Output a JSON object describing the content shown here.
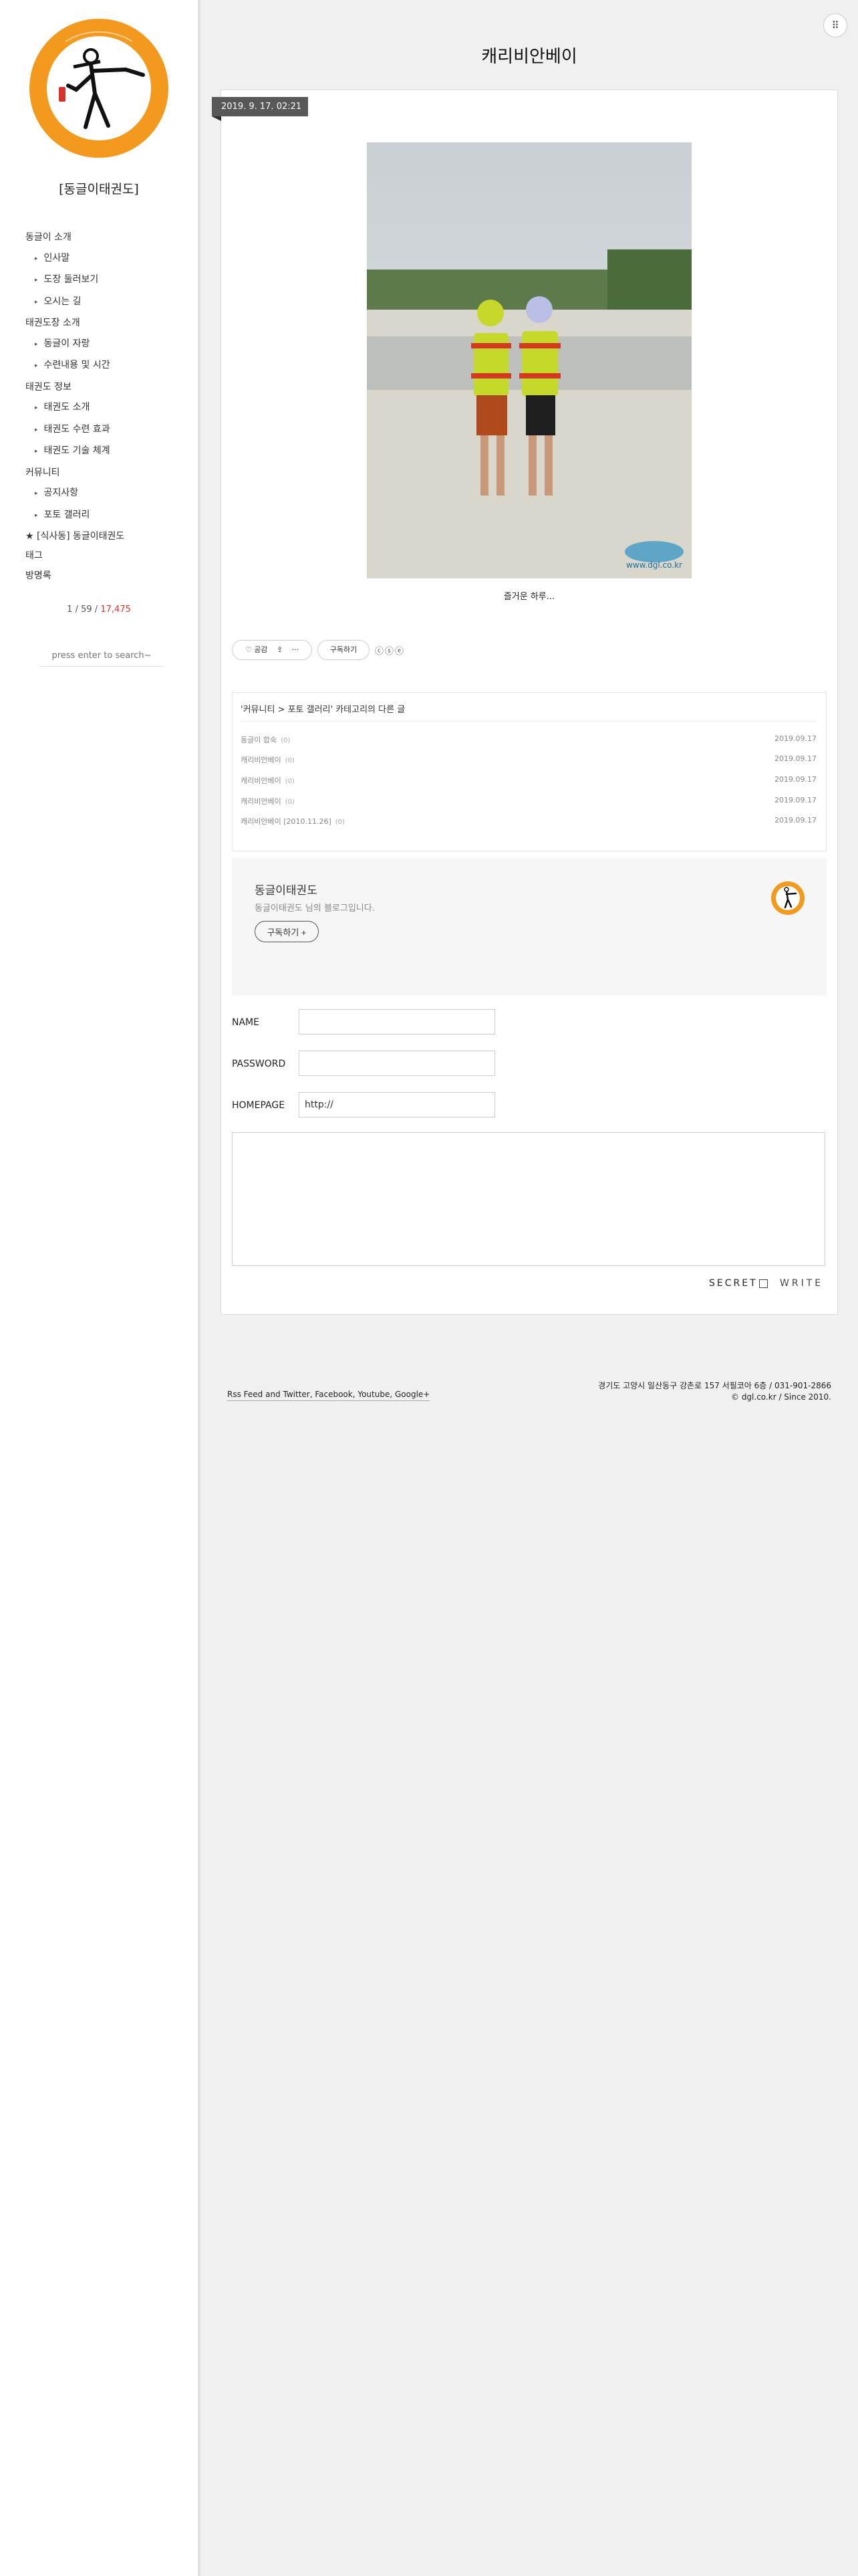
{
  "sidebar": {
    "blog_title": "[동글이태권도]",
    "nav": [
      {
        "label": "동글이 소개",
        "level": 0
      },
      {
        "label": "인사말",
        "level": 1
      },
      {
        "label": "도장 둘러보기",
        "level": 1
      },
      {
        "label": "오시는 길",
        "level": 1
      },
      {
        "label": "태권도장 소개",
        "level": 0
      },
      {
        "label": "동글이 자랑",
        "level": 1
      },
      {
        "label": "수련내용 및 시간",
        "level": 1
      },
      {
        "label": "태권도 정보",
        "level": 0
      },
      {
        "label": "태권도 소개",
        "level": 1
      },
      {
        "label": "태권도 수련 효과",
        "level": 1
      },
      {
        "label": "태권도 기술 체계",
        "level": 1
      },
      {
        "label": "커뮤니티",
        "level": 0
      },
      {
        "label": "공지사항",
        "level": 1
      },
      {
        "label": "포토 갤러리",
        "level": 1
      },
      {
        "label": "★ [식사동] 동글이태권도",
        "level": 0
      }
    ],
    "tag_link": "태그",
    "guestbook_link": "방명록",
    "counter": {
      "today": "1",
      "yesterday": "59",
      "total": "17,475",
      "sep": " / "
    },
    "search_placeholder": "press enter to search~"
  },
  "header": {
    "menu_icon": "menu-dots-icon",
    "menu_glyph": "⠿"
  },
  "post": {
    "title": "캐리비안베이",
    "date": "2019. 9. 17. 02:21",
    "caption": "즐거운 하루...",
    "watermark": "www.dgl.co.kr",
    "actions": {
      "like_label": "공감",
      "like_icon": "heart-icon",
      "share_icon": "share-icon",
      "more_label": "···",
      "subscribe_label": "구독하기",
      "ccl_glyphs": "ⓒⓢⓔ"
    }
  },
  "related": {
    "heading": "'커뮤니티 > 포토 갤러리' 카테고리의 다른 글",
    "items": [
      {
        "title": "동글이 합숙",
        "count": "(0)",
        "date": "2019.09.17"
      },
      {
        "title": "캐리비안베이",
        "count": "(0)",
        "date": "2019.09.17"
      },
      {
        "title": "캐리비안베이",
        "count": "(0)",
        "date": "2019.09.17"
      },
      {
        "title": "캐리비안베이",
        "count": "(0)",
        "date": "2019.09.17"
      },
      {
        "title": "캐리비안베이 [2010.11.26]",
        "count": "(0)",
        "date": "2019.09.17"
      }
    ]
  },
  "subscribe": {
    "name": "동글이태권도",
    "desc": "동글이태권도 님의 블로그입니다.",
    "button": "구독하기 +"
  },
  "comment_form": {
    "name_label": "NAME",
    "password_label": "PASSWORD",
    "homepage_label": "HOMEPAGE",
    "homepage_value": "http://",
    "secret_label": "SECRET",
    "write_label": "WRITE"
  },
  "footer": {
    "links": "Rss Feed and Twitter, Facebook, Youtube, Google+",
    "address": "경기도 고양시 일산동구 강촌로 157 서필코아 6층 / 031-901-2866",
    "copyright": "© dgl.co.kr / Since 2010."
  },
  "colors": {
    "accent_orange": "#f39a1e",
    "counter_red": "#e0322b",
    "date_tag": "#585858"
  }
}
